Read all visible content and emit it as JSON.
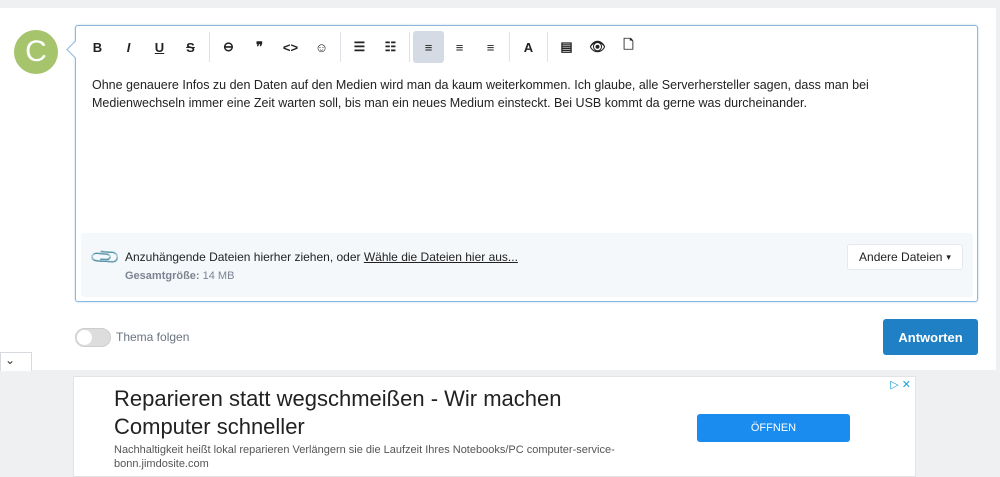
{
  "avatar": {
    "letter": "C",
    "color": "#a6c46c"
  },
  "toolbar": {
    "buttons": [
      {
        "name": "bold",
        "glyph": "B"
      },
      {
        "name": "italic",
        "glyph": "I"
      },
      {
        "name": "underline",
        "glyph": "U"
      },
      {
        "name": "strikethrough",
        "glyph": "S"
      },
      {
        "name": "link",
        "glyph": "⊖"
      },
      {
        "name": "quote",
        "glyph": "❞"
      },
      {
        "name": "code",
        "glyph": "<>"
      },
      {
        "name": "smiley",
        "glyph": "☺"
      },
      {
        "name": "bullet-list",
        "glyph": "☰"
      },
      {
        "name": "numbered-list",
        "glyph": "☷"
      },
      {
        "name": "align-left",
        "glyph": "≡"
      },
      {
        "name": "align-center",
        "glyph": "≡"
      },
      {
        "name": "align-right",
        "glyph": "≡"
      },
      {
        "name": "text-color",
        "glyph": "A"
      },
      {
        "name": "media",
        "glyph": "▤"
      },
      {
        "name": "preview",
        "glyph": "👁"
      },
      {
        "name": "draft",
        "glyph": "🗋"
      }
    ]
  },
  "editor": {
    "text": "Ohne genauere Infos zu den Daten auf den Medien wird man da kaum weiterkommen. Ich glaube, alle Serverhersteller sagen, dass man bei Medienwechseln immer eine Zeit warten soll, bis man ein neues Medium einsteckt. Bei USB kommt da gerne was durcheinander."
  },
  "attach": {
    "prompt": "Anzuhängende Dateien hierher ziehen, oder ",
    "link": "Wähle die Dateien hier aus...",
    "size_label": "Gesamtgröße:",
    "size_value": "14 MB",
    "other_label": "Andere Dateien",
    "caret": "▾"
  },
  "footer": {
    "follow_label": "Thema folgen",
    "follow_on": false,
    "reply_label": "Antworten",
    "reply_color": "#1f80c6",
    "chevron": "⌄"
  },
  "ad": {
    "title": "Reparieren statt wegschmeißen - Wir machen Computer schneller",
    "desc": "Nachhaltigkeit heißt lokal reparieren Verlängern sie die Laufzeit Ihres Notebooks/PC computer-service-bonn.jimdosite.com",
    "button": "ÖFFNEN",
    "choices": "▷ ✕"
  }
}
